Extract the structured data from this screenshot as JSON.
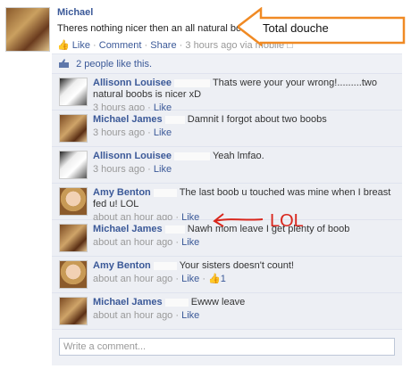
{
  "post": {
    "author": "Michael",
    "text": "Theres nothing nicer then an all natural boob",
    "like_label": "Like",
    "comment_label": "Comment",
    "share_label": "Share",
    "time": "3 hours ago via mobile",
    "separator": "·"
  },
  "annotation": {
    "text": "Total douche",
    "color": "#f08a24"
  },
  "likes": {
    "text": "2 people like this."
  },
  "comments": [
    {
      "author": "Allisonn Louisee",
      "text": "Thats were your your wrong!.........two natural boobs is nicer xD",
      "time": "3 hours ago",
      "like_label": "Like",
      "avatar": "photo-a"
    },
    {
      "author": "Michael James",
      "text": "Damnit I forgot about two boobs",
      "time": "3 hours ago",
      "like_label": "Like",
      "avatar": "photo-m"
    },
    {
      "author": "Allisonn Louisee",
      "text": "Yeah lmfao.",
      "time": "3 hours ago",
      "like_label": "Like",
      "avatar": "photo-a"
    },
    {
      "author": "Amy Benton",
      "text": "The last boob u touched was mine when I breast fed u! LOL",
      "time": "about an hour ago",
      "like_label": "Like",
      "avatar": "photo-b"
    },
    {
      "author": "Michael James",
      "text": "Nawh mom leave I get plenty of boob",
      "time": "about an hour ago",
      "like_label": "Like",
      "avatar": "photo-m"
    },
    {
      "author": "Amy Benton",
      "text": "Your sisters doesn't count!",
      "time": "about an hour ago",
      "like_label": "Like",
      "like_count": "1",
      "avatar": "photo-b"
    },
    {
      "author": "Michael James",
      "text": "Ewww leave",
      "time": "about an hour ago",
      "like_label": "Like",
      "avatar": "photo-m"
    }
  ],
  "lol_annotation": {
    "text": "LOL",
    "color": "#d9261c"
  },
  "comment_input": {
    "placeholder": "Write a comment..."
  }
}
